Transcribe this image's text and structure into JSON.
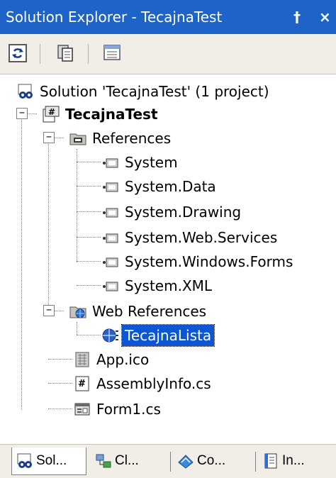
{
  "window": {
    "title": "Solution Explorer - TecajnaTest",
    "pin_glyph": "†",
    "close_glyph": "×"
  },
  "toolbar": {
    "buttons": [
      {
        "name": "refresh-button",
        "icon": "refresh-icon"
      },
      {
        "name": "show-all-files-button",
        "icon": "show-all-files-icon"
      },
      {
        "name": "properties-button",
        "icon": "properties-icon"
      }
    ]
  },
  "tree": {
    "solution": "Solution 'TecajnaTest' (1 project)",
    "project": "TecajnaTest",
    "references": "References",
    "ref_items": [
      "System",
      "System.Data",
      "System.Drawing",
      "System.Web.Services",
      "System.Windows.Forms",
      "System.XML"
    ],
    "web_references": "Web References",
    "web_ref_item": "TecajnaLista",
    "files": [
      "App.ico",
      "AssemblyInfo.cs",
      "Form1.cs"
    ],
    "expanded_glyph": "−"
  },
  "tabs": [
    {
      "label": "Sol...",
      "icon": "solution-explorer-icon",
      "active": true
    },
    {
      "label": "Cl...",
      "icon": "class-view-icon",
      "active": false
    },
    {
      "label": "Co...",
      "icon": "contents-icon",
      "active": false
    },
    {
      "label": "In...",
      "icon": "index-icon",
      "active": false
    }
  ],
  "colors": {
    "title_bar": "#1e64c8",
    "selection": "#0a56d4",
    "toolbar_bg": "#f0eee6"
  }
}
